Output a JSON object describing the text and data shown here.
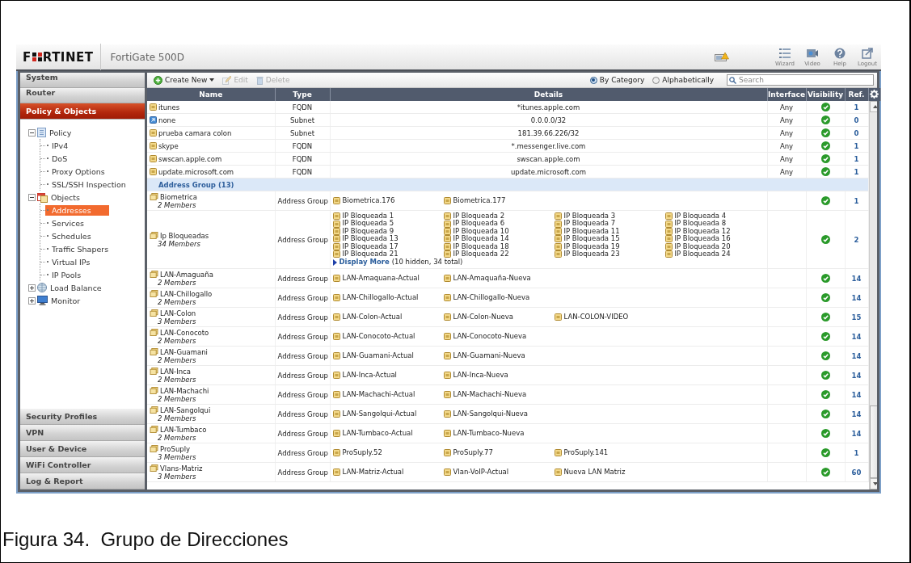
{
  "header": {
    "logo_left": "F",
    "logo_right": "RTINET",
    "product": "FortiGate 500D",
    "tools": [
      {
        "kind": "wizard",
        "label": "Wizard"
      },
      {
        "kind": "video",
        "label": "Video"
      },
      {
        "kind": "help",
        "label": "Help"
      },
      {
        "kind": "logout",
        "label": "Logout"
      }
    ]
  },
  "sidebar": {
    "sections_top": [
      {
        "label": "System",
        "selected": false
      },
      {
        "label": "Router",
        "selected": false
      },
      {
        "label": "Policy & Objects",
        "selected": true
      }
    ],
    "tree": [
      {
        "label": "Policy",
        "kind": "policy",
        "expanded": true,
        "children": [
          {
            "label": "IPv4",
            "selected": false
          },
          {
            "label": "DoS",
            "selected": false
          },
          {
            "label": "Proxy Options",
            "selected": false
          },
          {
            "label": "SSL/SSH Inspection",
            "selected": false
          }
        ]
      },
      {
        "label": "Objects",
        "kind": "objects",
        "expanded": true,
        "children": [
          {
            "label": "Addresses",
            "selected": true
          },
          {
            "label": "Services",
            "selected": false
          },
          {
            "label": "Schedules",
            "selected": false
          },
          {
            "label": "Traffic Shapers",
            "selected": false
          },
          {
            "label": "Virtual IPs",
            "selected": false
          },
          {
            "label": "IP Pools",
            "selected": false
          }
        ]
      },
      {
        "label": "Load Balance",
        "kind": "balance",
        "expanded": false
      },
      {
        "label": "Monitor",
        "kind": "monitor",
        "expanded": false
      }
    ],
    "sections_bottom": [
      {
        "label": "Security Profiles",
        "selected": false
      },
      {
        "label": "VPN",
        "selected": false
      },
      {
        "label": "User & Device",
        "selected": false
      },
      {
        "label": "WiFi Controller",
        "selected": false
      },
      {
        "label": "Log & Report",
        "selected": false
      }
    ]
  },
  "toolbar": {
    "actions": [
      {
        "kind": "create",
        "label": "Create New",
        "disabled": false
      },
      {
        "kind": "edit",
        "label": "Edit",
        "disabled": true
      },
      {
        "kind": "delete",
        "label": "Delete",
        "disabled": true
      }
    ],
    "sort": [
      {
        "label": "By Category",
        "selected": true
      },
      {
        "label": "Alphabetically",
        "selected": false
      }
    ],
    "search": {
      "placeholder": "Search"
    }
  },
  "table": {
    "columns": [
      "Name",
      "Type",
      "Details",
      "Interface",
      "Visibility",
      "Ref."
    ],
    "rows": [
      {
        "kind": "address",
        "name": "itunes",
        "type": "FQDN",
        "details": "*itunes.apple.com",
        "interface": "Any",
        "visible": true,
        "ref": "1"
      },
      {
        "kind": "builtin",
        "name": "none",
        "type": "Subnet",
        "details": "0.0.0.0/32",
        "interface": "Any",
        "visible": true,
        "ref": "0"
      },
      {
        "kind": "address",
        "name": "prueba camara colon",
        "type": "Subnet",
        "details": "181.39.66.226/32",
        "interface": "Any",
        "visible": true,
        "ref": "0"
      },
      {
        "kind": "address",
        "name": "skype",
        "type": "FQDN",
        "details": "*.messenger.live.com",
        "interface": "Any",
        "visible": true,
        "ref": "1"
      },
      {
        "kind": "address",
        "name": "swscan.apple.com",
        "type": "FQDN",
        "details": "swscan.apple.com",
        "interface": "Any",
        "visible": true,
        "ref": "1"
      },
      {
        "kind": "address",
        "name": "update.microsoft.com",
        "type": "FQDN",
        "details": "update.microsoft.com",
        "interface": "Any",
        "visible": true,
        "ref": "1"
      },
      {
        "kind": "category",
        "label": "Address Group (13)"
      },
      {
        "kind": "group",
        "name": "Biometrica",
        "count": "2 Members",
        "type": "Address Group",
        "members": [
          "Biometrica.176",
          "Biometrica.177"
        ],
        "visible": true,
        "ref": "1"
      },
      {
        "kind": "group",
        "name": "Ip Bloqueadas",
        "count": "34 Members",
        "type": "Address Group",
        "members": [
          "IP Bloqueada 1",
          "IP Bloqueada 2",
          "IP Bloqueada 3",
          "IP Bloqueada 4",
          "IP Bloqueada 5",
          "IP Bloqueada 6",
          "IP Bloqueada 7",
          "IP Bloqueada 8",
          "IP Bloqueada 9",
          "IP Bloqueada 10",
          "IP Bloqueada 11",
          "IP Bloqueada 12",
          "IP Bloqueada 13",
          "IP Bloqueada 14",
          "IP Bloqueada 15",
          "IP Bloqueada 16",
          "IP Bloqueada 17",
          "IP Bloqueada 18",
          "IP Bloqueada 19",
          "IP Bloqueada 20",
          "IP Bloqueada 21",
          "IP Bloqueada 22",
          "IP Bloqueada 23",
          "IP Bloqueada 24"
        ],
        "more": {
          "link": "Display More",
          "note": "(10 hidden, 34 total)"
        },
        "visible": true,
        "ref": "2"
      },
      {
        "kind": "group",
        "name": "LAN-Amaguaña",
        "count": "2 Members",
        "type": "Address Group",
        "members": [
          "LAN-Amaquana-Actual",
          "LAN-Amaquaña-Nueva"
        ],
        "visible": true,
        "ref": "14"
      },
      {
        "kind": "group",
        "name": "LAN-Chillogallo",
        "count": "2 Members",
        "type": "Address Group",
        "members": [
          "LAN-Chillogallo-Actual",
          "LAN-Chillogallo-Nueva"
        ],
        "visible": true,
        "ref": "14"
      },
      {
        "kind": "group",
        "name": "LAN-Colon",
        "count": "3 Members",
        "type": "Address Group",
        "members": [
          "LAN-Colon-Actual",
          "LAN-Colon-Nueva",
          "LAN-COLON-VIDEO"
        ],
        "visible": true,
        "ref": "15"
      },
      {
        "kind": "group",
        "name": "LAN-Conocoto",
        "count": "2 Members",
        "type": "Address Group",
        "members": [
          "LAN-Conocoto-Actual",
          "LAN-Conocoto-Nueva"
        ],
        "visible": true,
        "ref": "14"
      },
      {
        "kind": "group",
        "name": "LAN-Guamani",
        "count": "2 Members",
        "type": "Address Group",
        "members": [
          "LAN-Guamani-Actual",
          "LAN-Guamani-Nueva"
        ],
        "visible": true,
        "ref": "14"
      },
      {
        "kind": "group",
        "name": "LAN-Inca",
        "count": "2 Members",
        "type": "Address Group",
        "members": [
          "LAN-Inca-Actual",
          "LAN-Inca-Nueva"
        ],
        "visible": true,
        "ref": "14"
      },
      {
        "kind": "group",
        "name": "LAN-Machachi",
        "count": "2 Members",
        "type": "Address Group",
        "members": [
          "LAN-Machachi-Actual",
          "LAN-Machachi-Nueva"
        ],
        "visible": true,
        "ref": "14"
      },
      {
        "kind": "group",
        "name": "LAN-Sangolqui",
        "count": "2 Members",
        "type": "Address Group",
        "members": [
          "LAN-Sangolqui-Actual",
          "LAN-Sangolqui-Nueva"
        ],
        "visible": true,
        "ref": "14"
      },
      {
        "kind": "group",
        "name": "LAN-Tumbaco",
        "count": "2 Members",
        "type": "Address Group",
        "members": [
          "LAN-Tumbaco-Actual",
          "LAN-Tumbaco-Nueva"
        ],
        "visible": true,
        "ref": "14"
      },
      {
        "kind": "group",
        "name": "ProSuply",
        "count": "3 Members",
        "type": "Address Group",
        "members": [
          "ProSuply.52",
          "ProSuply.77",
          "ProSuply.141"
        ],
        "visible": true,
        "ref": "1"
      },
      {
        "kind": "group",
        "name": "Vlans-Matriz",
        "count": "3 Members",
        "type": "Address Group",
        "members": [
          "LAN-Matriz-Actual",
          "Vlan-VoIP-Actual",
          "Nueva LAN Matriz"
        ],
        "visible": true,
        "ref": "60"
      }
    ]
  },
  "caption": "Figura 34.  Grupo de Direcciones"
}
